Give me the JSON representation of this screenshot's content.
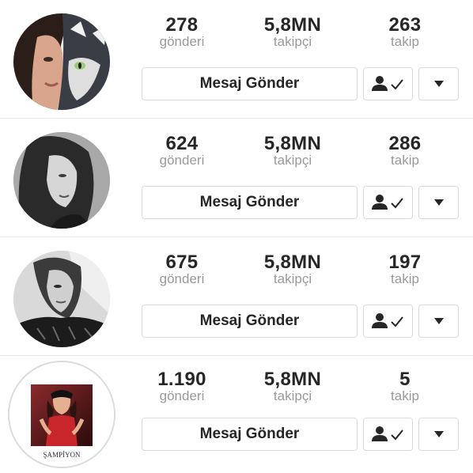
{
  "profiles": [
    {
      "posts": "278",
      "posts_label": "gönderi",
      "followers": "5,8MN",
      "followers_label": "takipçi",
      "following": "263",
      "following_label": "takip",
      "message_button": "Mesaj Gönder",
      "avatar_caption": ""
    },
    {
      "posts": "624",
      "posts_label": "gönderi",
      "followers": "5,8MN",
      "followers_label": "takipçi",
      "following": "286",
      "following_label": "takip",
      "message_button": "Mesaj Gönder",
      "avatar_caption": ""
    },
    {
      "posts": "675",
      "posts_label": "gönderi",
      "followers": "5,8MN",
      "followers_label": "takipçi",
      "following": "197",
      "following_label": "takip",
      "message_button": "Mesaj Gönder",
      "avatar_caption": ""
    },
    {
      "posts": "1.190",
      "posts_label": "gönderi",
      "followers": "5,8MN",
      "followers_label": "takipçi",
      "following": "5",
      "following_label": "takip",
      "message_button": "Mesaj Gönder",
      "avatar_caption": "ŞAMPİYON"
    }
  ],
  "icons": {
    "following": "person-check-icon",
    "dropdown": "caret-down-icon"
  },
  "colors": {
    "text": "#262626",
    "muted": "#999999",
    "border": "#dbdbdb"
  }
}
